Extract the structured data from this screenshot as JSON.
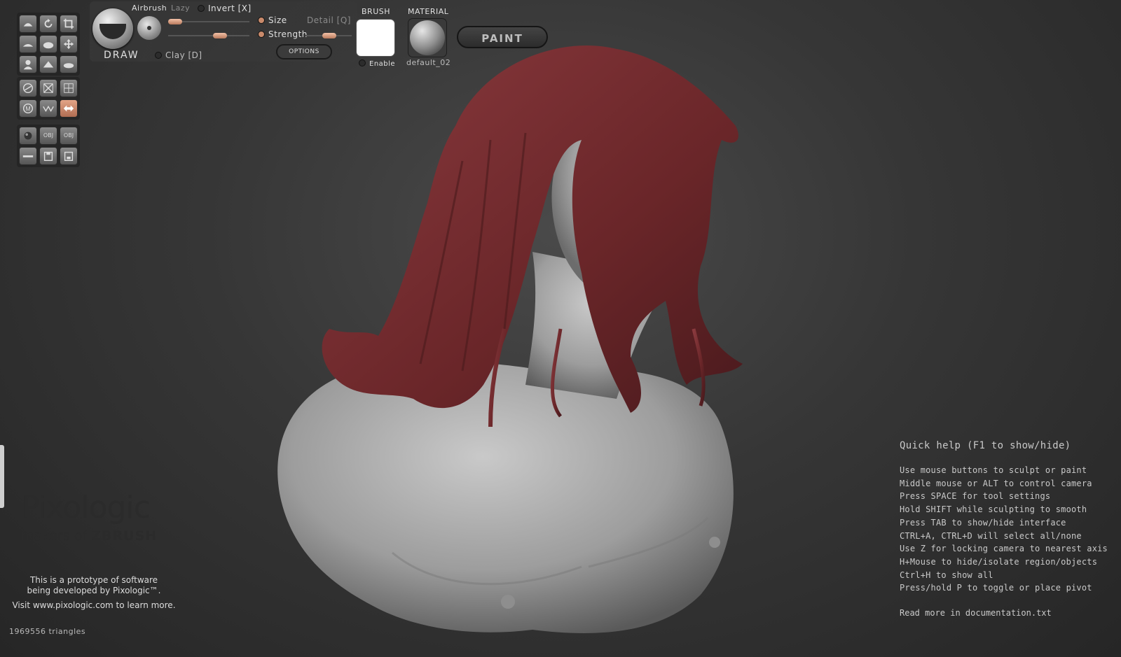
{
  "toolbar": {
    "brush_name": "DRAW",
    "airbrush_label": "Airbrush",
    "lazy_label": "Lazy",
    "invert_label": "Invert [X]",
    "size_label": "Size",
    "detail_label": "Detail [Q]",
    "strength_label": "Strength",
    "clay_label": "Clay [D]",
    "options_label": "OPTIONS",
    "brush_header": "BRUSH",
    "enable_label": "Enable",
    "material_header": "MATERIAL",
    "material_name": "default_02",
    "paint_label": "PAINT",
    "accent_color": "#c98a6b"
  },
  "left_tools": {
    "group1": [
      "brush-icon",
      "rotate-icon",
      "crop-icon",
      "clay-icon",
      "inflate-icon",
      "move-icon",
      "bust-icon",
      "pinch-icon",
      "smooth-icon"
    ],
    "group2": [
      "lasso-icon",
      "delete-icon",
      "grid-icon",
      "m-icon",
      "wave-icon",
      "symmetry-icon"
    ],
    "group3": [
      "sphere-icon",
      "obj-import-icon",
      "obj-export-icon",
      "plane-icon",
      "save-icon",
      "save-as-icon"
    ],
    "group2_obj": [
      "OBJ",
      "OBJ"
    ]
  },
  "branding": {
    "company": "Pixologic",
    "tagline_prefix": "makers of",
    "product": "ZBRUSH",
    "prototype_line1": "This is a prototype of software",
    "prototype_line2": "being developed by Pixologic™.",
    "visit": "Visit www.pixologic.com to learn more."
  },
  "status": {
    "triangles": "1969556 triangles"
  },
  "quick_help": {
    "title": "Quick help (F1 to show/hide)",
    "lines": [
      "Use mouse buttons to sculpt or paint",
      "Middle mouse or ALT to control camera",
      "Press SPACE for tool settings",
      "Hold SHIFT while sculpting to smooth",
      "Press TAB to show/hide interface",
      "CTRL+A, CTRL+D will select all/none",
      "Use Z for locking camera to nearest axis",
      "H+Mouse to hide/isolate region/objects",
      "Ctrl+H to show all",
      "Press/hold P to toggle or place pivot"
    ],
    "more": "Read more in documentation.txt"
  },
  "viewport": {
    "hair_color": "#6e2a2e",
    "skin_color": "#a8a8a8"
  }
}
